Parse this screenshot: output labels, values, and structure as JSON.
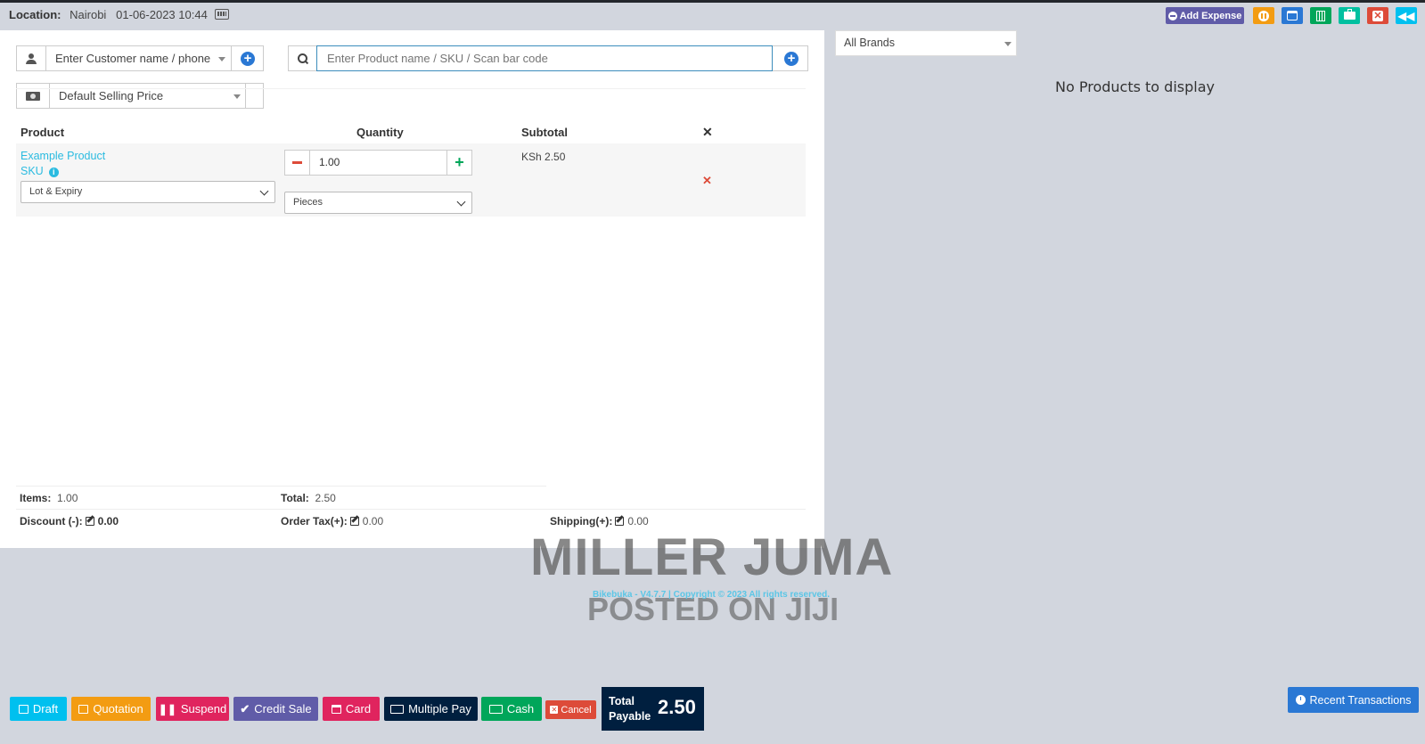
{
  "topbar": {
    "location_label": "Location:",
    "location_name": "Nairobi",
    "datetime": "01-06-2023 10:44",
    "add_expense_label": "Add Expense",
    "colors": {
      "add_expense": "#605ca8",
      "pause": "#f39c12",
      "window": "#2a78d4",
      "calculator": "#00a65a",
      "briefcase": "#00c0a0",
      "close": "#dd4b39",
      "back": "#00c0ef"
    }
  },
  "customer": {
    "placeholder": "Enter Customer name / phone"
  },
  "price_group": {
    "selected": "Default Selling Price"
  },
  "product_search": {
    "placeholder": "Enter Product name / SKU / Scan bar code"
  },
  "table": {
    "headers": {
      "product": "Product",
      "quantity": "Quantity",
      "subtotal": "Subtotal"
    },
    "rows": [
      {
        "name": "Example Product",
        "sku": "SKU",
        "lot_select": "Lot & Expiry",
        "quantity": "1.00",
        "unit": "Pieces",
        "subtotal": "KSh 2.50"
      }
    ]
  },
  "totals": {
    "items_label": "Items:",
    "items_value": "1.00",
    "total_label": "Total:",
    "total_value": "2.50",
    "discount_label": "Discount (-):",
    "discount_value": "0.00",
    "order_tax_label": "Order Tax(+):",
    "order_tax_value": "0.00",
    "shipping_label": "Shipping(+):",
    "shipping_value": "0.00"
  },
  "brands": {
    "selected": "All Brands"
  },
  "products_panel": {
    "empty_message": "No Products to display"
  },
  "watermark": {
    "line1": "MILLER JUMA",
    "line2": "POSTED ON JIJI",
    "copyright": "Bikebuka - V4.7.7 | Copyright © 2023 All rights reserved."
  },
  "actions": {
    "draft": "Draft",
    "quotation": "Quotation",
    "suspend": "Suspend",
    "credit_sale": "Credit Sale",
    "card": "Card",
    "multiple_pay": "Multiple Pay",
    "cash": "Cash",
    "cancel": "Cancel",
    "total_payable_line1": "Total",
    "total_payable_line2": "Payable",
    "total_payable_value": "2.50",
    "recent_transactions": "Recent Transactions"
  }
}
